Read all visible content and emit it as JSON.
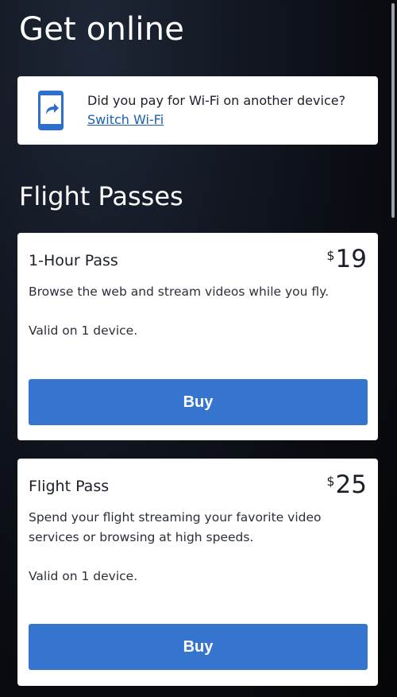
{
  "header": {
    "title": "Get online"
  },
  "switch_card": {
    "question": "Did you pay for Wi-Fi on another device?",
    "link_label": "Switch Wi-Fi",
    "icon": "phone-switch-icon"
  },
  "section": {
    "title": "Flight Passes"
  },
  "passes": [
    {
      "name": "1-Hour Pass",
      "currency": "$",
      "price": "19",
      "description": "Browse the web and stream videos while you fly.",
      "valid": "Valid on 1 device.",
      "buy_label": "Buy"
    },
    {
      "name": "Flight Pass",
      "currency": "$",
      "price": "25",
      "description": "Spend your flight streaming your favorite video services or browsing at high speeds.",
      "valid": "Valid on 1 device.",
      "buy_label": "Buy"
    }
  ],
  "colors": {
    "accent": "#3575cf",
    "link": "#1a5fb4",
    "card_bg": "#ffffff",
    "page_bg": "#0a0c12"
  }
}
